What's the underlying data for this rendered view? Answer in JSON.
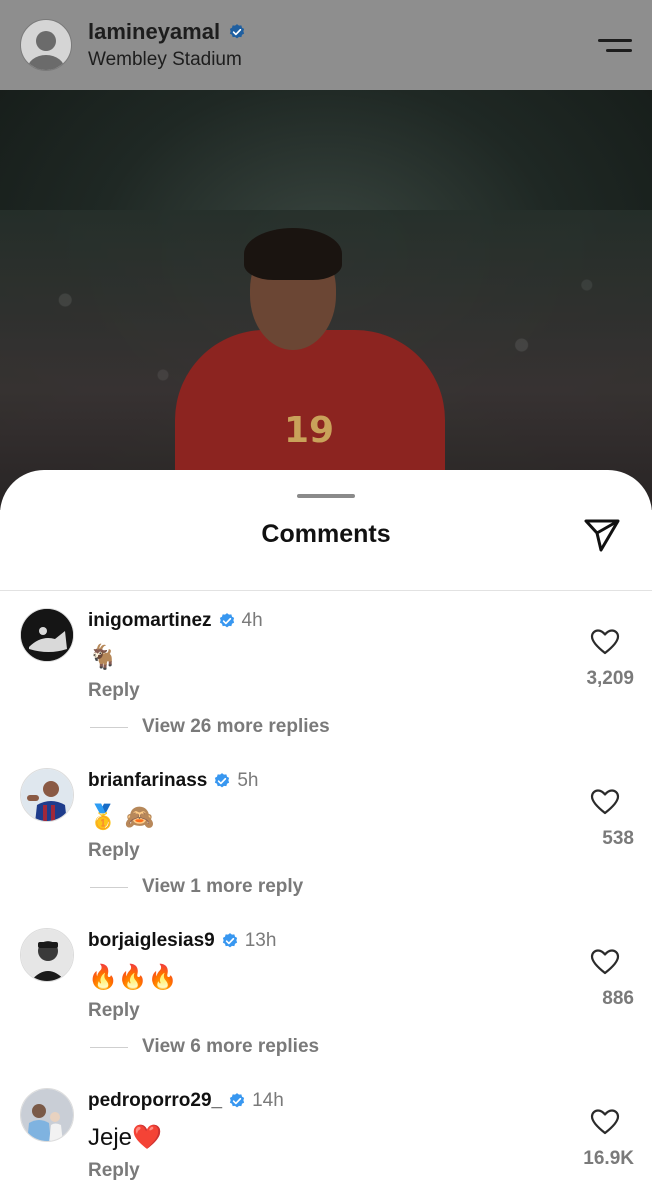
{
  "post": {
    "username": "lamineyamal",
    "location": "Wembley Stadium",
    "photo_shirt_number": "19"
  },
  "sheet": {
    "title": "Comments"
  },
  "comments": [
    {
      "username": "inigomartinez",
      "time": "4h",
      "text": "🐐",
      "reply_label": "Reply",
      "likes": "3,209",
      "more_replies": "View 26 more replies"
    },
    {
      "username": "brianfarinass",
      "time": "5h",
      "text": "🥇 🙈",
      "reply_label": "Reply",
      "likes": "538",
      "more_replies": "View 1 more reply"
    },
    {
      "username": "borjaiglesias9",
      "time": "13h",
      "text": "🔥🔥🔥",
      "reply_label": "Reply",
      "likes": "886",
      "more_replies": "View 6 more replies"
    },
    {
      "username": "pedroporro29_",
      "time": "14h",
      "text": "Jeje❤️",
      "reply_label": "Reply",
      "likes": "16.9K",
      "more_replies": ""
    }
  ],
  "colors": {
    "verified": "#3897f0",
    "secondary_text": "#7a7a7a",
    "header_dim": "#8e8e8e"
  }
}
